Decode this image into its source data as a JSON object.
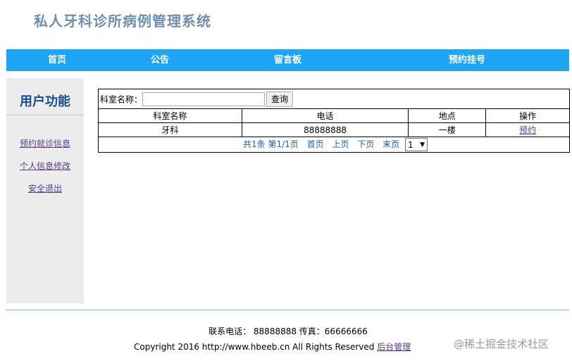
{
  "header": {
    "title": "私人牙科诊所病例管理系统"
  },
  "nav": {
    "items": [
      {
        "label": "首页"
      },
      {
        "label": "公告"
      },
      {
        "label": "留言板"
      },
      {
        "label": "预约挂号"
      }
    ]
  },
  "sidebar": {
    "title": "用户功能",
    "links": [
      {
        "label": "预约就诊信息"
      },
      {
        "label": "个人信息修改"
      },
      {
        "label": "安全退出"
      }
    ]
  },
  "search": {
    "label": "科室名称：",
    "value": "",
    "button_label": "查询"
  },
  "table": {
    "headers": [
      "科室名称",
      "电话",
      "地点",
      "操作"
    ],
    "rows": [
      {
        "name": "牙科",
        "phone": "88888888",
        "location": "一楼",
        "action": "预约"
      }
    ]
  },
  "pager": {
    "summary": "共1条 第1/1页",
    "first": "首页",
    "prev": "上页",
    "next": "下页",
    "last": "末页",
    "selected_page": "1",
    "dropdown_arrow": "▼"
  },
  "footer": {
    "contact": "联系电话： 88888888 传真：66666666",
    "copyright": "Copyright 2016 http://www.hbeeb.cn All Rights Reserved",
    "admin_link": "后台管理",
    "watermark": "@稀土掘金技术社区"
  }
}
